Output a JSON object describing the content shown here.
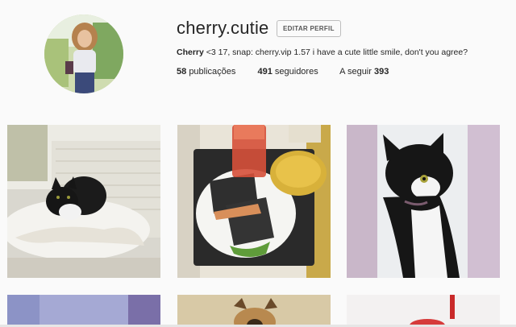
{
  "profile": {
    "username": "cherry.cutie",
    "edit_label": "EDITAR PERFIL",
    "bio_name": "Cherry",
    "bio_text": " <3 17, snap: cherry.vip 1.57 i have a cute little smile, don't you agree?",
    "stats": {
      "posts_count": "58",
      "posts_label": "publicações",
      "followers_count": "491",
      "followers_label": "seguidores",
      "following_label": "A seguir",
      "following_count": "393"
    }
  },
  "colors": {
    "background": "#fafafa",
    "text": "#262626",
    "button_border": "#bdbdbd"
  },
  "grid": {
    "posts": [
      {
        "subject": "black-white-cat-on-table"
      },
      {
        "subject": "sandwich-soup-juice"
      },
      {
        "subject": "black-white-cat-portrait"
      },
      {
        "subject": "purple-blurred"
      },
      {
        "subject": "dog"
      },
      {
        "subject": "red-drink"
      }
    ]
  }
}
